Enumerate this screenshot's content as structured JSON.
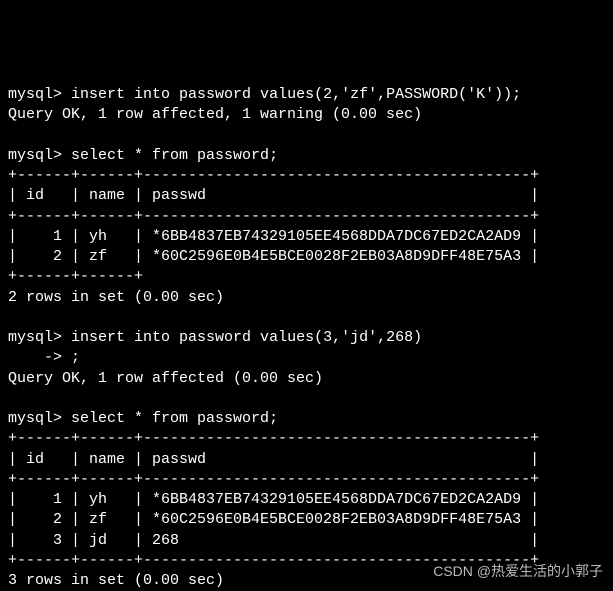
{
  "prompt": "mysql>",
  "cont": "    ->",
  "cmd": {
    "insert1": "insert into password values(2,'zf',PASSWORD('K'));",
    "select": "select * from password;",
    "insert2": "insert into password values(3,'jd',268)",
    "semi": ";"
  },
  "msg": {
    "ok1": "Query OK, 1 row affected, 1 warning (0.00 sec)",
    "ok2": "Query OK, 1 row affected (0.00 sec)",
    "rows2": "2 rows in set (0.00 sec)",
    "rows3": "3 rows in set (0.00 sec)"
  },
  "tbl": {
    "sep": "+------+------+-------------------------------------------+",
    "tail": "+------+------+                                            ",
    "head": "| id   | name | passwd                                    |",
    "r1": "|    1 | yh   | *6BB4837EB74329105EE4568DDA7DC67ED2CA2AD9 |",
    "r2": "|    2 | zf   | *60C2596E0B4E5BCE0028F2EB03A8D9DFF48E75A3 |",
    "r3": "|    3 | jd   | 268                                       |"
  },
  "table_data": {
    "columns": [
      "id",
      "name",
      "passwd"
    ],
    "result1": [
      {
        "id": 1,
        "name": "yh",
        "passwd": "*6BB4837EB74329105EE4568DDA7DC67ED2CA2AD9"
      },
      {
        "id": 2,
        "name": "zf",
        "passwd": "*60C2596E0B4E5BCE0028F2EB03A8D9DFF48E75A3"
      }
    ],
    "result2": [
      {
        "id": 1,
        "name": "yh",
        "passwd": "*6BB4837EB74329105EE4568DDA7DC67ED2CA2AD9"
      },
      {
        "id": 2,
        "name": "zf",
        "passwd": "*60C2596E0B4E5BCE0028F2EB03A8D9DFF48E75A3"
      },
      {
        "id": 3,
        "name": "jd",
        "passwd": "268"
      }
    ]
  },
  "watermark": "CSDN @热爱生活的小郭子"
}
